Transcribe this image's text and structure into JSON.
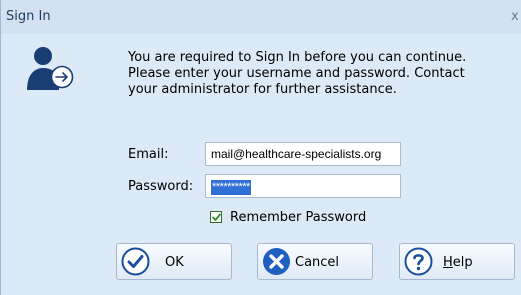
{
  "window": {
    "title": "Sign In",
    "close_glyph": "x"
  },
  "icons": {
    "user": "user-signin-icon",
    "ok": "checkmark-circle-icon",
    "cancel": "x-circle-icon",
    "help": "question-circle-icon"
  },
  "message": {
    "line1": "You are required to Sign In before you can continue.",
    "line2": "Please enter your username and password. Contact",
    "line3": "your administrator for further assistance."
  },
  "form": {
    "email_label": "Email:",
    "email_value": "mail@healthcare-specialists.org",
    "password_label": "Password:",
    "password_value": "**********",
    "remember_label": "Remember Password",
    "remember_checked": true
  },
  "buttons": {
    "ok": "OK",
    "cancel": "Cancel",
    "help_mnemonic": "H",
    "help_rest": "elp"
  },
  "colors": {
    "accent": "#1f5fbf",
    "dialog_bg": "#dce9f6",
    "selection": "#2f6fd6",
    "cancel_icon": "#1f5fbf",
    "check": "#2f8a2f"
  }
}
